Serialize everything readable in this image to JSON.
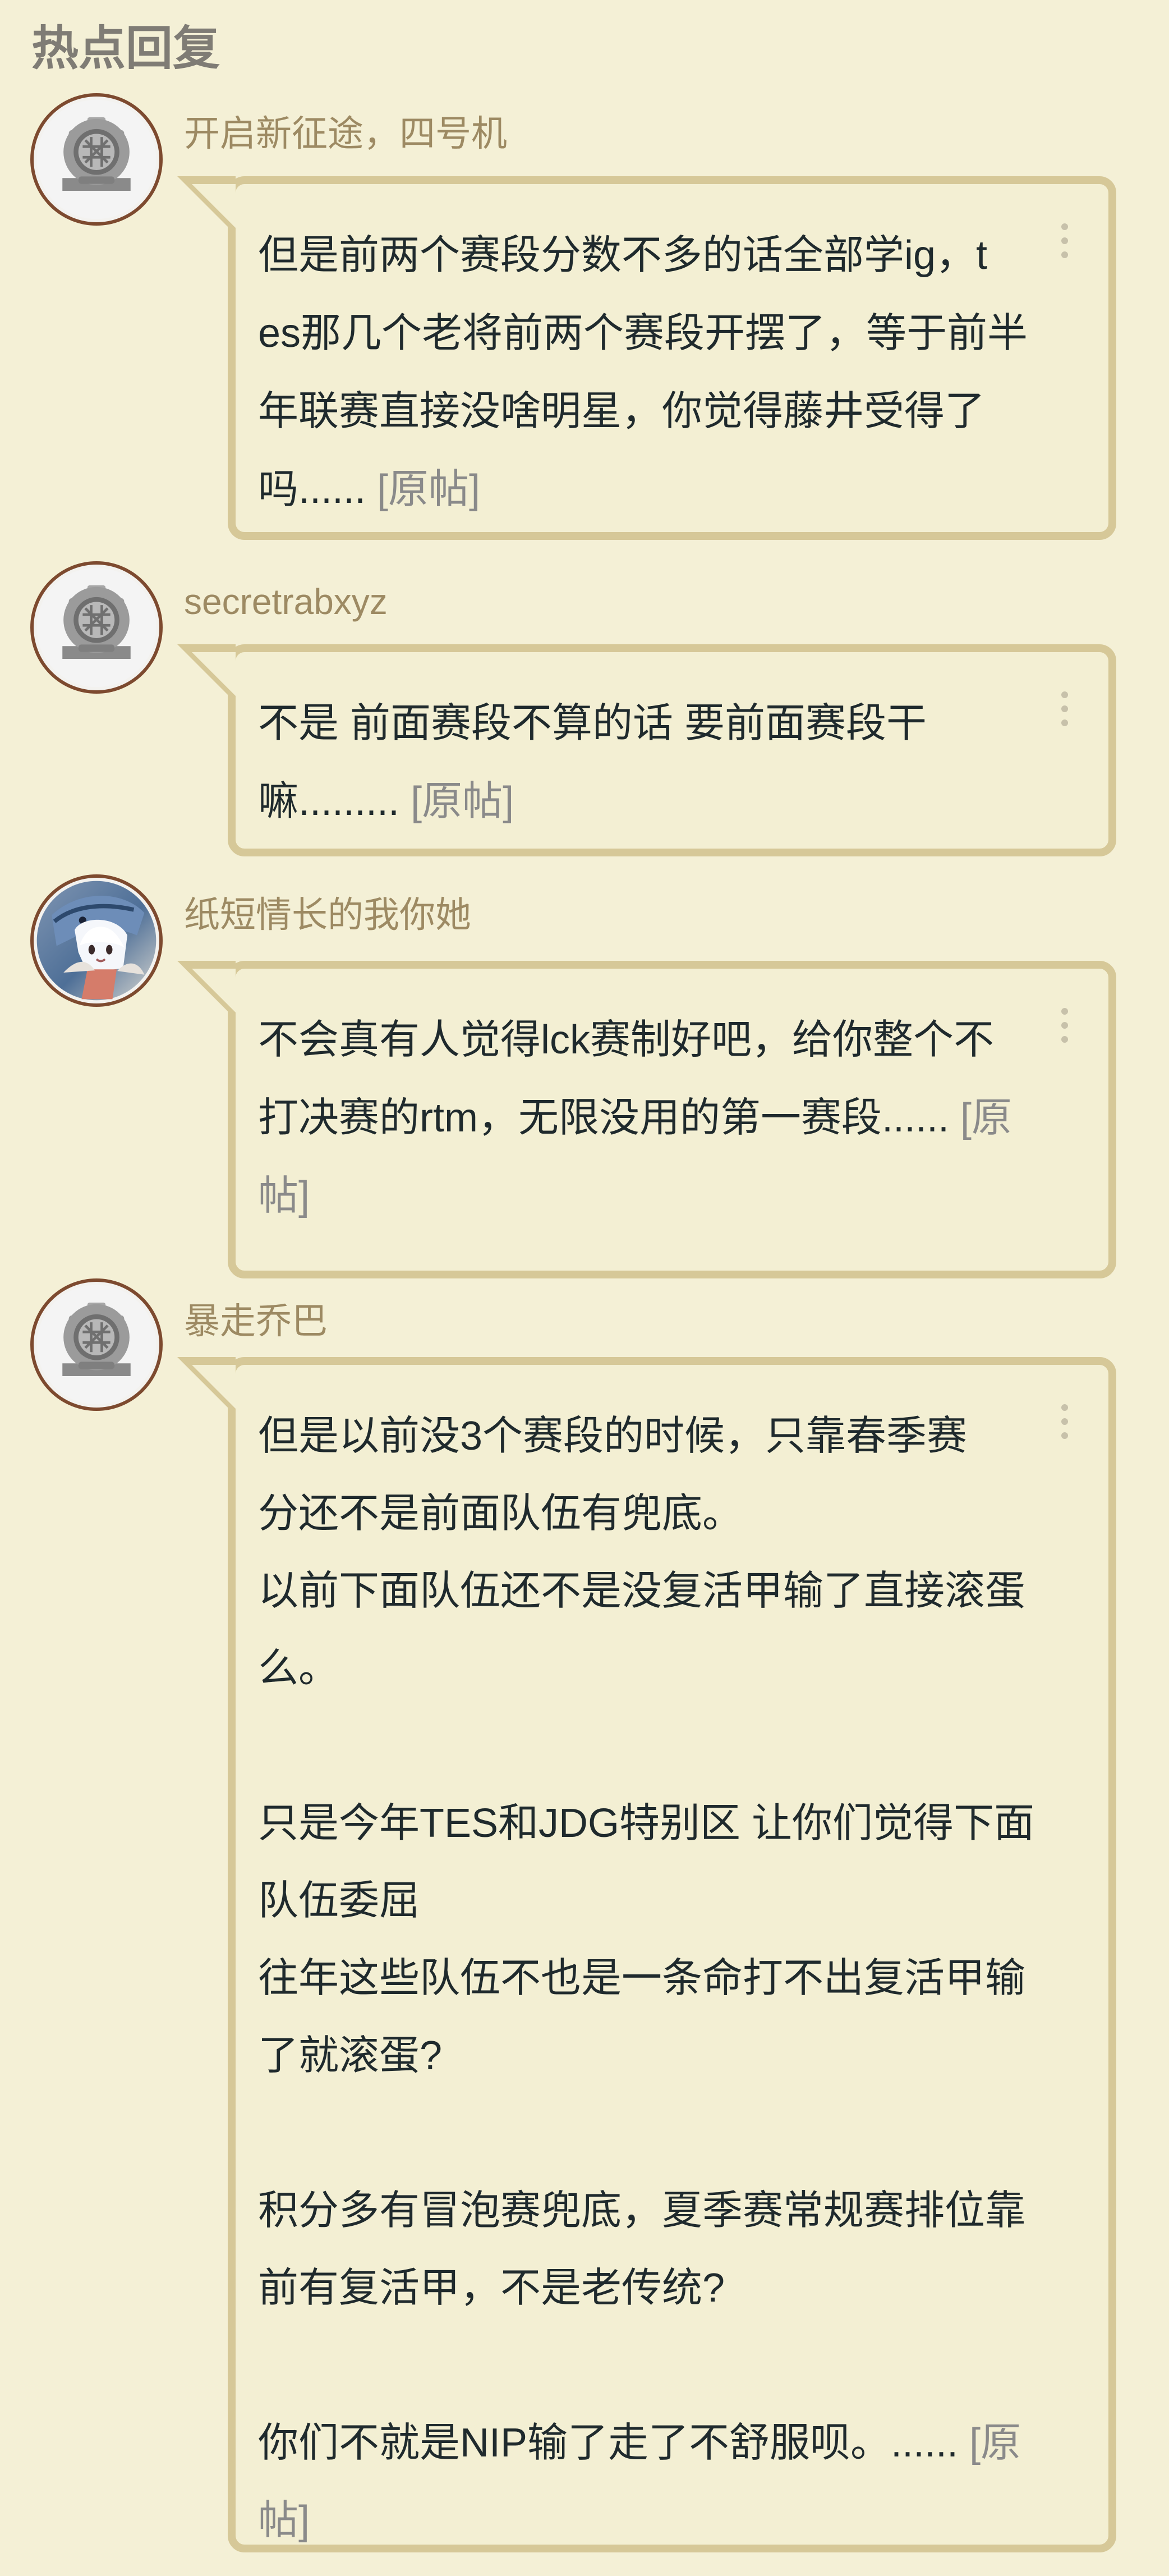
{
  "section": {
    "title": "热点回复"
  },
  "posts": [
    {
      "username": "开启新征途，四号机",
      "avatar_icon": "diver-helmet-icon",
      "text": "但是前两个赛段分数不多的话全部学ig，t\nes那几个老将前两个赛段开摆了，等于前半\n年联赛直接没啥明星，你觉得藤井受得了\n吗......",
      "source_label": "[原帖]"
    },
    {
      "username": "secretrabxyz",
      "avatar_icon": "diver-helmet-icon",
      "text": "不是 前面赛段不算的话 要前面赛段干\n嘛.........",
      "source_label": "[原帖]"
    },
    {
      "username": "纸短情长的我你她",
      "avatar_icon": "anime-girl-fish-avatar",
      "text": "不会真有人觉得lck赛制好吧，给你整个不\n打决赛的rtm，无限没用的第一赛段......",
      "source_label": "[原\n帖]"
    },
    {
      "username": "暴走乔巴",
      "avatar_icon": "diver-helmet-icon",
      "text": "但是以前没3个赛段的时候，只靠春季赛\n分还不是前面队伍有兜底。\n以前下面队伍还不是没复活甲输了直接滚蛋\n么。\n\n只是今年TES和JDG特别区 让你们觉得下面\n队伍委屈\n往年这些队伍不也是一条命打不出复活甲输\n了就滚蛋?\n\n积分多有冒泡赛兜底，夏季赛常规赛排位靠\n前有复活甲，不是老传统?\n\n你们不就是NIP输了走了不舒服呗。......",
      "source_label": "[原\n帖]"
    }
  ],
  "colors": {
    "page_bg": "#f4f0d6",
    "bubble_border": "#d6c898",
    "username": "#9d8a63",
    "title": "#7f7c75",
    "text": "#1f2a2d",
    "link": "#8a8a8a"
  }
}
